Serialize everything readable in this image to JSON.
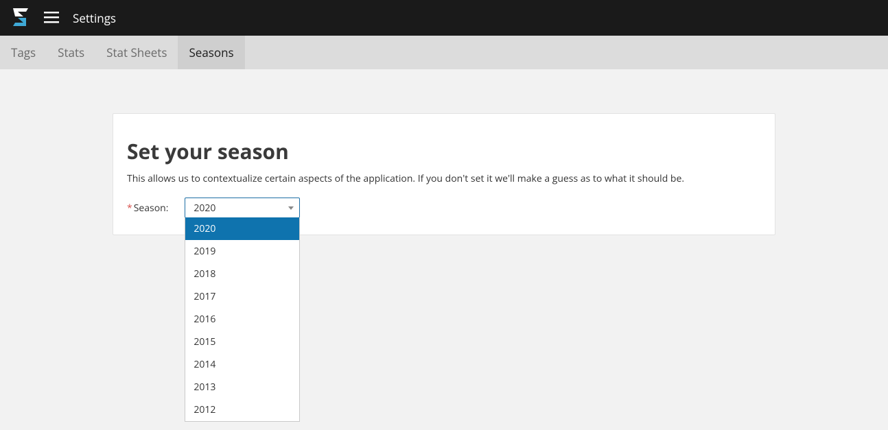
{
  "header": {
    "title": "Settings"
  },
  "tabs": {
    "items": [
      {
        "label": "Tags"
      },
      {
        "label": "Stats"
      },
      {
        "label": "Stat Sheets"
      },
      {
        "label": "Seasons"
      }
    ],
    "activeIndex": 3
  },
  "card": {
    "title": "Set your season",
    "description": "This allows us to contextualize certain aspects of the application. If you don't set it we'll make a guess as to what it should be.",
    "fieldLabel": "Season:",
    "selected": "2020",
    "options": [
      "2020",
      "2019",
      "2018",
      "2017",
      "2016",
      "2015",
      "2014",
      "2013",
      "2012"
    ]
  }
}
